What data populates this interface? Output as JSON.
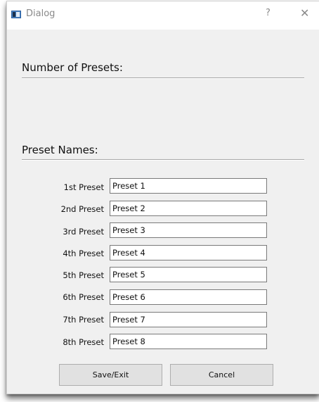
{
  "window": {
    "title": "Dialog",
    "help_glyph": "?",
    "close_glyph": "✕"
  },
  "sections": {
    "number_of_presets": "Number of Presets:",
    "preset_names": "Preset Names:"
  },
  "presets": [
    {
      "label": "1st Preset",
      "value": "Preset 1"
    },
    {
      "label": "2nd Preset",
      "value": "Preset 2"
    },
    {
      "label": "3rd Preset",
      "value": "Preset 3"
    },
    {
      "label": "4th Preset",
      "value": "Preset 4"
    },
    {
      "label": "5th Preset",
      "value": "Preset 5"
    },
    {
      "label": "6th Preset",
      "value": "Preset 6"
    },
    {
      "label": "7th Preset",
      "value": "Preset 7"
    },
    {
      "label": "8th Preset",
      "value": "Preset 8"
    }
  ],
  "buttons": {
    "save_exit": "Save/Exit",
    "cancel": "Cancel"
  }
}
